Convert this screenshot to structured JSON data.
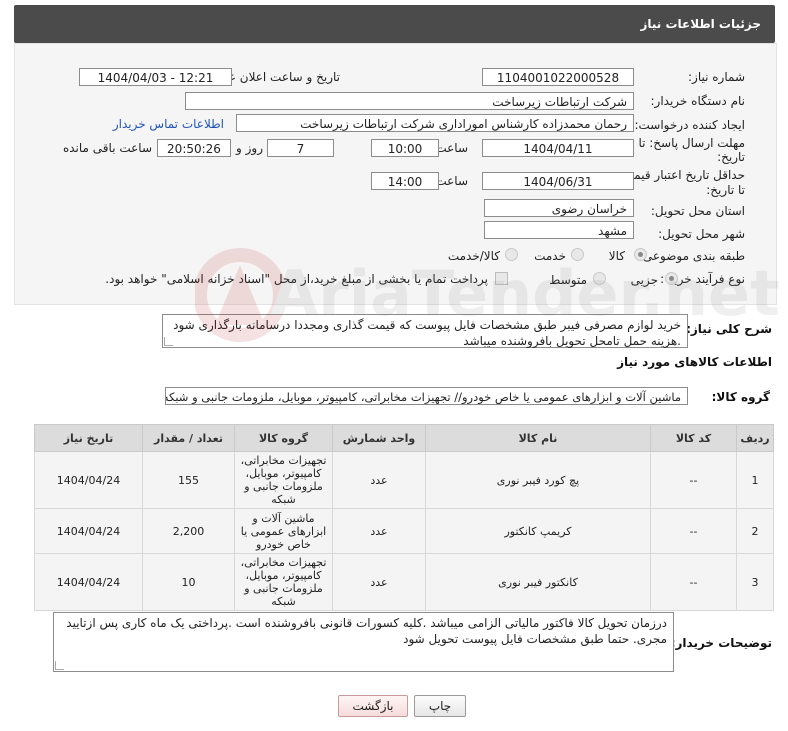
{
  "header": {
    "title": "جزئیات اطلاعات نیاز"
  },
  "form": {
    "need_number_label": "شماره نیاز:",
    "need_number": "1104001022000528",
    "announce_label": "تاریخ و ساعت اعلان عمومی:",
    "announce_value": "1404/04/03 - 12:21",
    "buyer_org_label": "نام دستگاه خریدار:",
    "buyer_org": "شرکت ارتباطات زیرساخت",
    "creator_label": "ایجاد کننده درخواست:",
    "creator": "رحمان محمدزاده کارشناس امورادارى  شرکت ارتباطات زیرساخت",
    "contact_link": "اطلاعات تماس خریدار",
    "deadline_label_1": "مهلت ارسال پاسخ: تا",
    "deadline_label_2": "تاریخ:",
    "deadline_date": "1404/04/11",
    "time_word": "ساعت",
    "deadline_time": "10:00",
    "days_value": "7",
    "days_word": "روز و",
    "remaining_time": "20:50:26",
    "remaining_word": "ساعت باقی مانده",
    "validity_label_1": "حداقل تاریخ اعتبار قیمت:",
    "validity_label_2": "تا تاریخ:",
    "validity_date": "1404/06/31",
    "validity_time": "14:00",
    "province_label": "استان محل تحویل:",
    "province": "خراسان رضوی",
    "city_label": "شهر محل تحویل:",
    "city": "مشهد",
    "category_label": "طبقه بندی موضوعی:",
    "category_options": [
      "کالا",
      "خدمت",
      "کالا/خدمت"
    ],
    "category_selected": "کالا",
    "process_label": "نوع فرآیند خرید :",
    "process_options": [
      "جزیی",
      "متوسط"
    ],
    "process_selected": "جزیی",
    "process_note": "پرداخت تمام یا بخشی از مبلغ خرید،از محل \"اسناد خزانه اسلامی\" خواهد بود."
  },
  "summary": {
    "label": "شرح کلی نیاز:",
    "text": "خرید لوازم مصرفی فیبر طبق مشخصات فایل پیوست که قیمت گذاری ومجددا درسامانه بارگذاری شود .هزینه حمل تامحل تحویل بافروشنده میباشد"
  },
  "goods": {
    "section_title": "اطلاعات کالاهای مورد نیاز",
    "group_label": "گروه کالا:",
    "group_value": "ماشین آلات و ابزارهای عمومی یا خاص خودرو// تجهیزات مخابراتی، کامپیوتر، موبایل، ملزومات جانبی و شبکه",
    "columns": [
      "ردیف",
      "کد کالا",
      "نام کالا",
      "واحد شمارش",
      "گروه کالا",
      "تعداد / مقدار",
      "تاریخ نیاز"
    ],
    "rows": [
      {
        "row": "1",
        "code": "--",
        "name": "پچ کورد فیبر نوری",
        "unit": "عدد",
        "group": "تجهیزات مخابراتی، کامپیوتر، موبایل، ملزومات جانبی و شبکه",
        "qty": "155",
        "date": "1404/04/24"
      },
      {
        "row": "2",
        "code": "--",
        "name": "کریمپ کانکتور",
        "unit": "عدد",
        "group": "ماشین آلات و ابزارهای عمومی یا خاص خودرو",
        "qty": "2,200",
        "date": "1404/04/24"
      },
      {
        "row": "3",
        "code": "--",
        "name": "کانکتور فیبر نوری",
        "unit": "عدد",
        "group": "تجهیزات مخابراتی، کامپیوتر، موبایل، ملزومات جانبی و شبکه",
        "qty": "10",
        "date": "1404/04/24"
      }
    ]
  },
  "buyer_notes": {
    "label": "توضیحات خریدار:",
    "text": "درزمان تحویل کالا فاکتور مالیاتی الزامی میباشد .کلیه کسورات قانونی بافروشنده است .پرداختی یک ماه کاری پس ازتایید مجری. حتما طبق مشخصات فایل پیوست تحویل شود"
  },
  "buttons": {
    "print": "چاپ",
    "back": "بازگشت"
  },
  "watermark": {
    "text": "AriaTender.net"
  },
  "colors": {
    "header_bg": "#4b4b4b",
    "link": "#2255bb",
    "panel_bg": "#f5f5f5",
    "table_header": "#dcdcdc"
  }
}
